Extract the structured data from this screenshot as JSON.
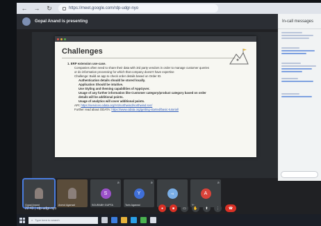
{
  "browser": {
    "url": "https://meet.google.com/rdp-udgr-nyo",
    "back_icon": "arrow-left-icon",
    "forward_icon": "arrow-right-icon",
    "reload_icon": "reload-icon"
  },
  "meet": {
    "presenting_label": "Gopal Anand is presenting",
    "chat_header": "In-call messages"
  },
  "slide": {
    "window_title": "",
    "title": "Challenges",
    "lines": [
      {
        "kind": "h",
        "text": "1.  ERP extension use-case."
      },
      {
        "kind": "p",
        "text": "Companies often need to share their data with 3rd party vendors in order to manage customer queries"
      },
      {
        "kind": "p",
        "text": "or do information processing for which that company doesn't have expertise"
      },
      {
        "kind": "p",
        "text": "Challenge: Build an app to check order details based on Order ID."
      },
      {
        "kind": "b",
        "text": "Authentication details should be stored locally."
      },
      {
        "kind": "b",
        "text": "Application Should be intuitive."
      },
      {
        "kind": "b",
        "text": "Use Styling and theming capabilities of AppGyver."
      },
      {
        "kind": "b",
        "text": "Usage of any further information like Customer category/product category based on order"
      },
      {
        "kind": "b",
        "text": "details will be additional points."
      },
      {
        "kind": "b",
        "text": "Usage of analytics will cover additional points."
      }
    ],
    "api_label": "API:",
    "api_url": "https://services.odata.org/V4/northwind/northwind.svc/",
    "further_label": "Further read about ODATA:",
    "further_url": "https://www.odata.org/getting-started/basic-tutorial/"
  },
  "participants": [
    {
      "name": "Gopal Anand",
      "type": "photo-person",
      "active": true,
      "muted": false
    },
    {
      "name": "Anmol Agarwal",
      "type": "photo",
      "active": false,
      "muted": false
    },
    {
      "name": "SOURABH GUPTA",
      "initial": "S",
      "color": "purple",
      "muted": true
    },
    {
      "name": "Tarin Agarwal",
      "initial": "Y",
      "color": "blue",
      "muted": true
    },
    {
      "name": "",
      "initial": "+9",
      "color": "lightblue",
      "muted": false
    },
    {
      "name": "You",
      "initial": "A",
      "color": "red",
      "muted": true
    }
  ],
  "controls": {
    "time": "22:43",
    "meeting_code": "rdp-udgr-nyo"
  },
  "taskbar": {
    "search_placeholder": "Type here to search"
  },
  "colors": {
    "meet_bg": "#202124",
    "accent_blue": "#4a7de0",
    "end_call_red": "#d93025",
    "link_blue": "#2c58b8"
  }
}
